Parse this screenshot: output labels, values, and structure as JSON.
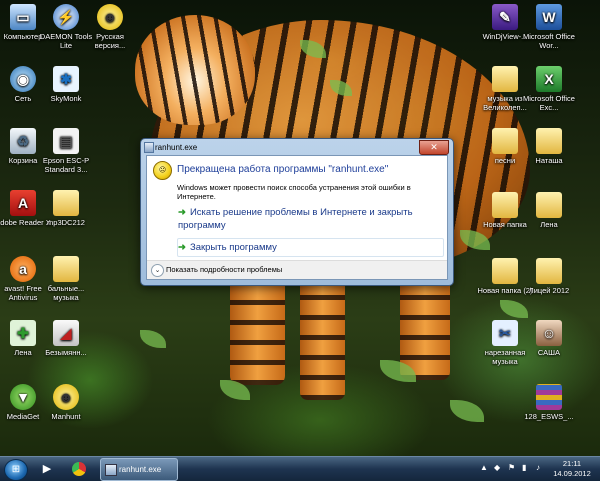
{
  "desktop": {
    "icons_left": [
      {
        "label": "Компьютер",
        "icon": "computer-icon"
      },
      {
        "label": "DAEMON Tools Lite",
        "icon": "daemon-tools-icon"
      },
      {
        "label": "Русская версия...",
        "icon": "smiley-icon"
      },
      {
        "label": "Сеть",
        "icon": "network-icon"
      },
      {
        "label": "SkyMonk",
        "icon": "skymonk-icon"
      },
      {
        "label": "Корзина",
        "icon": "recycle-bin-icon"
      },
      {
        "label": "Epson ESC-P Standard 3...",
        "icon": "printer-icon"
      },
      {
        "label": "Adobe Reader X",
        "icon": "adobe-reader-icon"
      },
      {
        "label": "mp3DC212",
        "icon": "folder-icon"
      },
      {
        "label": "avast! Free Antivirus",
        "icon": "avast-icon"
      },
      {
        "label": "бальные... музыка",
        "icon": "folder-icon"
      },
      {
        "label": "Лена",
        "icon": "shortcut-icon"
      },
      {
        "label": "Безымянн...",
        "icon": "document-icon"
      },
      {
        "label": "MediaGet",
        "icon": "mediaget-icon"
      },
      {
        "label": "Manhunt",
        "icon": "manhunt-icon"
      }
    ],
    "icons_right": [
      {
        "label": "WinDjView-...",
        "icon": "windjview-icon"
      },
      {
        "label": "Microsoft Office Wor...",
        "icon": "word-icon"
      },
      {
        "label": "музыка из Великолеп...",
        "icon": "folder-icon"
      },
      {
        "label": "Microsoft Office Exc...",
        "icon": "excel-icon"
      },
      {
        "label": "песни",
        "icon": "folder-icon"
      },
      {
        "label": "Наташа",
        "icon": "folder-icon"
      },
      {
        "label": "Новая папка",
        "icon": "folder-icon"
      },
      {
        "label": "Лена",
        "icon": "folder-icon"
      },
      {
        "label": "Новая папка (2)",
        "icon": "folder-icon"
      },
      {
        "label": "Лицей 2012",
        "icon": "folder-icon"
      },
      {
        "label": "нарезанная музыка",
        "icon": "scissors-icon"
      },
      {
        "label": "САША",
        "icon": "photo-icon"
      },
      {
        "label": "128_ESWS_...",
        "icon": "archive-icon"
      }
    ]
  },
  "dialog": {
    "title": "ranhunt.exe",
    "close_glyph": "✕",
    "heading": "Прекращена работа программы \"ranhunt.exe\"",
    "subtext": "Windows может провести поиск способа устранения этой ошибки в Интернете.",
    "option1": "Искать решение проблемы в Интернете и закрыть программу",
    "option2": "Закрыть программу",
    "arrow_glyph": "➜",
    "details": "Показать подробности проблемы",
    "accent_color": "#1f3f9a"
  },
  "taskbar": {
    "start_glyph": "⊞",
    "task_label": "ranhunt.exe",
    "time": "21:11",
    "date": "14.09.2012"
  }
}
